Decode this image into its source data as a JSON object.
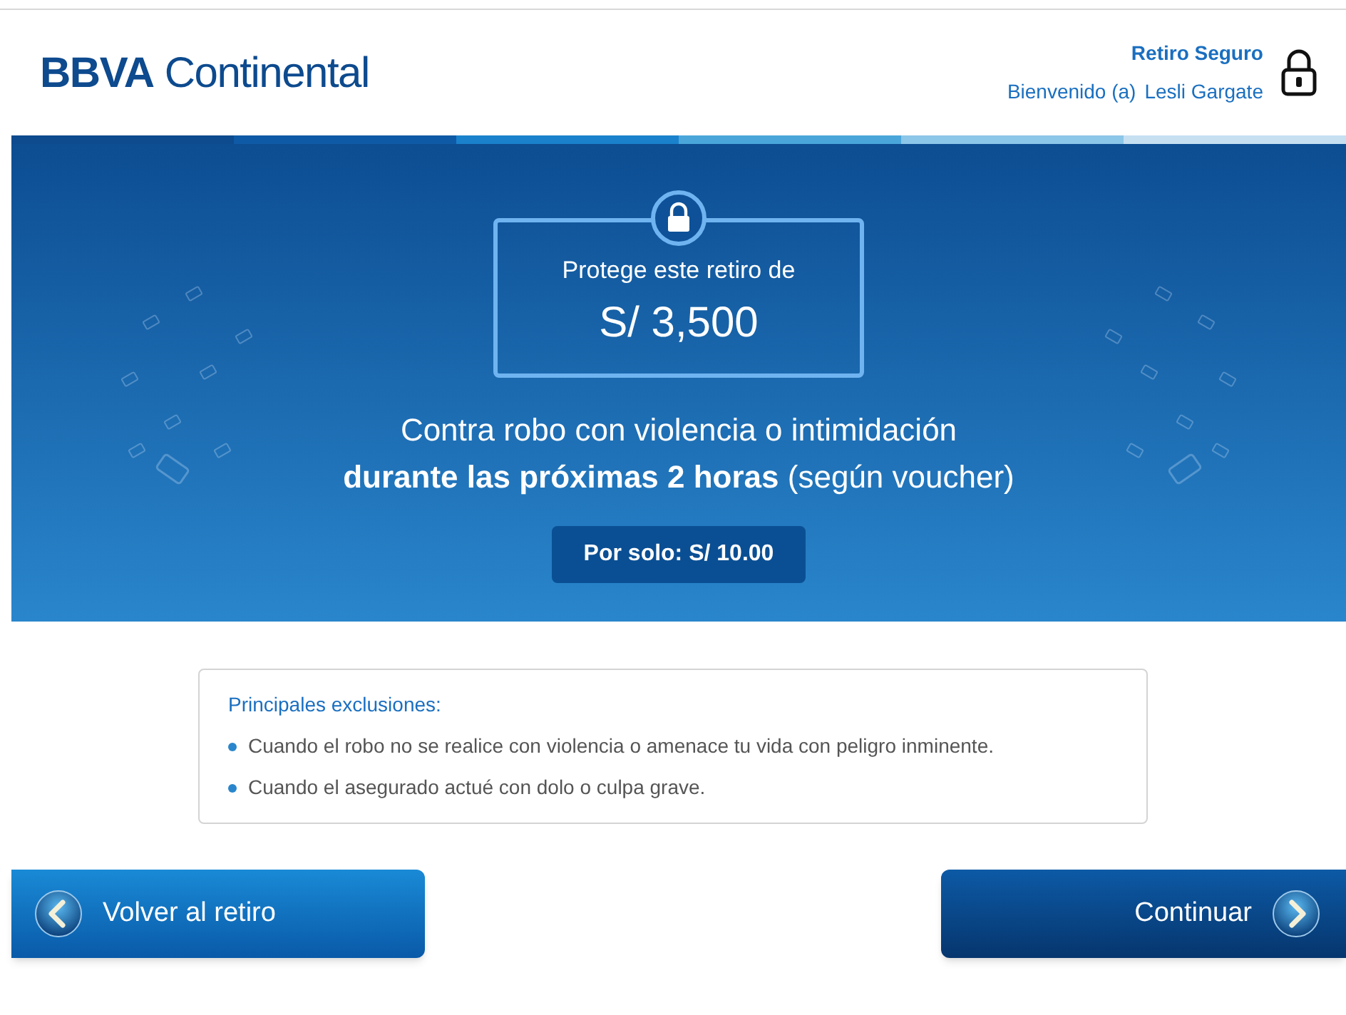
{
  "header": {
    "logo": "**BBVA** Continental",
    "title": "Retiro Seguro",
    "welcome": "Bienvenido (a)",
    "user": "Lesli Gargate"
  },
  "banner": {
    "protect_label": "Protege este retiro de",
    "amount": "S/ 3,500",
    "line1": "Contra robo con violencia o intimidación",
    "line2": "**durante las próximas 2 horas** (según voucher)",
    "price": "Por solo: S/ 10.00"
  },
  "exclusions": {
    "title": "Principales exclusiones:",
    "items": [
      "Cuando el robo no se realice con violencia o amenace tu vida con peligro inminente.",
      "Cuando el asegurado actué con dolo o culpa grave."
    ]
  },
  "buttons": {
    "back": "Volver al retiro",
    "next": "Continuar"
  }
}
